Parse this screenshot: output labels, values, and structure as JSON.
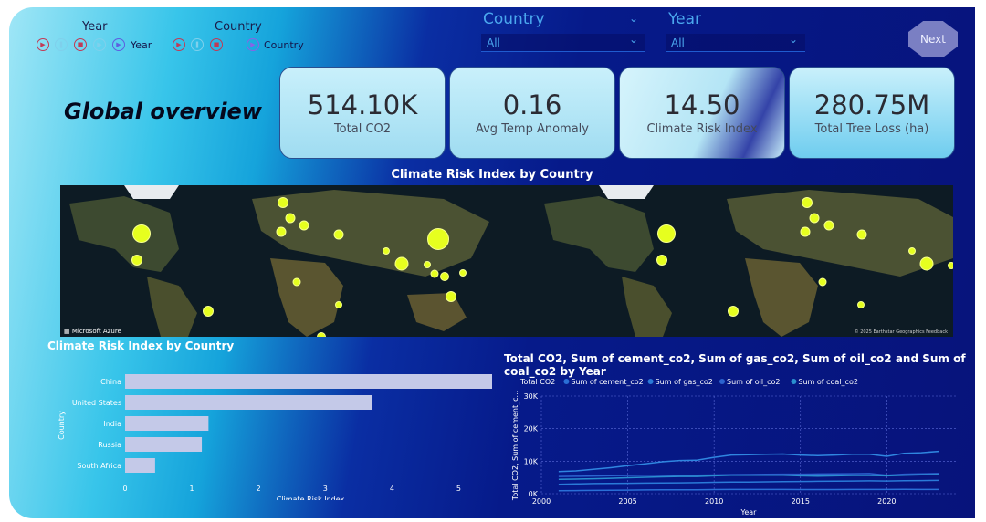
{
  "slicers": {
    "year_title": "Year",
    "country_title": "Country",
    "year_play_label": "Year",
    "country_play_label": "Country"
  },
  "icons": [
    "play-icon",
    "pause-icon",
    "stop-icon",
    "next-icon",
    "fast-forward-icon",
    "chevron-down-icon"
  ],
  "dropdowns": {
    "country": {
      "title": "Country",
      "value": "All"
    },
    "year": {
      "title": "Year",
      "value": "All"
    }
  },
  "next_button": "Next",
  "page_title": "Global overview",
  "kpis": [
    {
      "value": "514.10K",
      "label": "Total CO2"
    },
    {
      "value": "0.16",
      "label": "Avg Temp Anomaly"
    },
    {
      "value": "14.50",
      "label": "Climate Risk Index"
    },
    {
      "value": "280.75M",
      "label": "Total Tree Loss (ha)"
    }
  ],
  "map": {
    "title": "Climate Risk Index by Country",
    "brand": "Microsoft Azure",
    "credit": "© 2025 Earthstar Geographics  Feedback"
  },
  "chart_data": [
    {
      "type": "bar",
      "title": "Climate Risk Index by Country",
      "categories": [
        "China",
        "United States",
        "India",
        "Russia",
        "South Africa"
      ],
      "values": [
        5.5,
        3.7,
        1.25,
        1.15,
        0.45
      ],
      "xlabel": "Climate Risk Index",
      "ylabel": "Country",
      "xlim": [
        0,
        5.5
      ],
      "xticks": [
        "0",
        "1",
        "2",
        "3",
        "4",
        "5"
      ],
      "grid": false,
      "bar_color": "#c4c9e8"
    },
    {
      "type": "line",
      "title": "Total CO2, Sum of cement_co2, Sum of gas_co2, Sum of oil_co2 and Sum of coal_co2 by Year",
      "xlabel": "Year",
      "ylabel": "Total CO2, Sum of cement_c...",
      "x": [
        2001,
        2002,
        2003,
        2004,
        2005,
        2006,
        2007,
        2008,
        2009,
        2010,
        2011,
        2012,
        2013,
        2014,
        2015,
        2016,
        2017,
        2018,
        2019,
        2020,
        2021,
        2022,
        2023
      ],
      "xlim": [
        2000,
        2024
      ],
      "xticks": [
        "2000",
        "2005",
        "2010",
        "2015",
        "2020"
      ],
      "ylim": [
        0,
        30000
      ],
      "yticks": [
        "0K",
        "10K",
        "20K",
        "30K"
      ],
      "grid": true,
      "legend_placement": "top-left",
      "series": [
        {
          "name": "Total CO2",
          "color": "#2f86e0",
          "values": [
            6800,
            7000,
            7500,
            8000,
            8600,
            9200,
            9800,
            10200,
            10300,
            11200,
            11900,
            12000,
            12100,
            12200,
            11900,
            11700,
            11900,
            12100,
            12100,
            11500,
            12400,
            12600,
            13000
          ]
        },
        {
          "name": "Sum of cement_co2",
          "color": "#2a6fd6",
          "values": [
            900,
            950,
            1000,
            1050,
            1100,
            1150,
            1200,
            1200,
            1200,
            1250,
            1300,
            1300,
            1300,
            1300,
            1250,
            1250,
            1250,
            1300,
            1300,
            1300,
            1350,
            1300,
            1300
          ]
        },
        {
          "name": "Sum of gas_co2",
          "color": "#2a7ad8",
          "values": [
            2900,
            3000,
            3100,
            3150,
            3200,
            3250,
            3300,
            3350,
            3400,
            3500,
            3550,
            3600,
            3650,
            3700,
            3750,
            3800,
            3850,
            3900,
            3950,
            3900,
            4000,
            4050,
            4100
          ]
        },
        {
          "name": "Sum of oil_co2",
          "color": "#2c63cf",
          "values": [
            5300,
            5350,
            5450,
            5550,
            5600,
            5650,
            5700,
            5700,
            5650,
            5750,
            5850,
            5900,
            5950,
            6000,
            6000,
            6050,
            6100,
            6150,
            6200,
            5700,
            6000,
            6100,
            6200
          ]
        },
        {
          "name": "Sum of coal_co2",
          "color": "#2a8fd0",
          "values": [
            4400,
            4500,
            4600,
            4750,
            4900,
            5050,
            5200,
            5300,
            5300,
            5500,
            5650,
            5700,
            5700,
            5650,
            5500,
            5400,
            5500,
            5600,
            5600,
            5500,
            5700,
            5800,
            5900
          ]
        }
      ]
    }
  ]
}
